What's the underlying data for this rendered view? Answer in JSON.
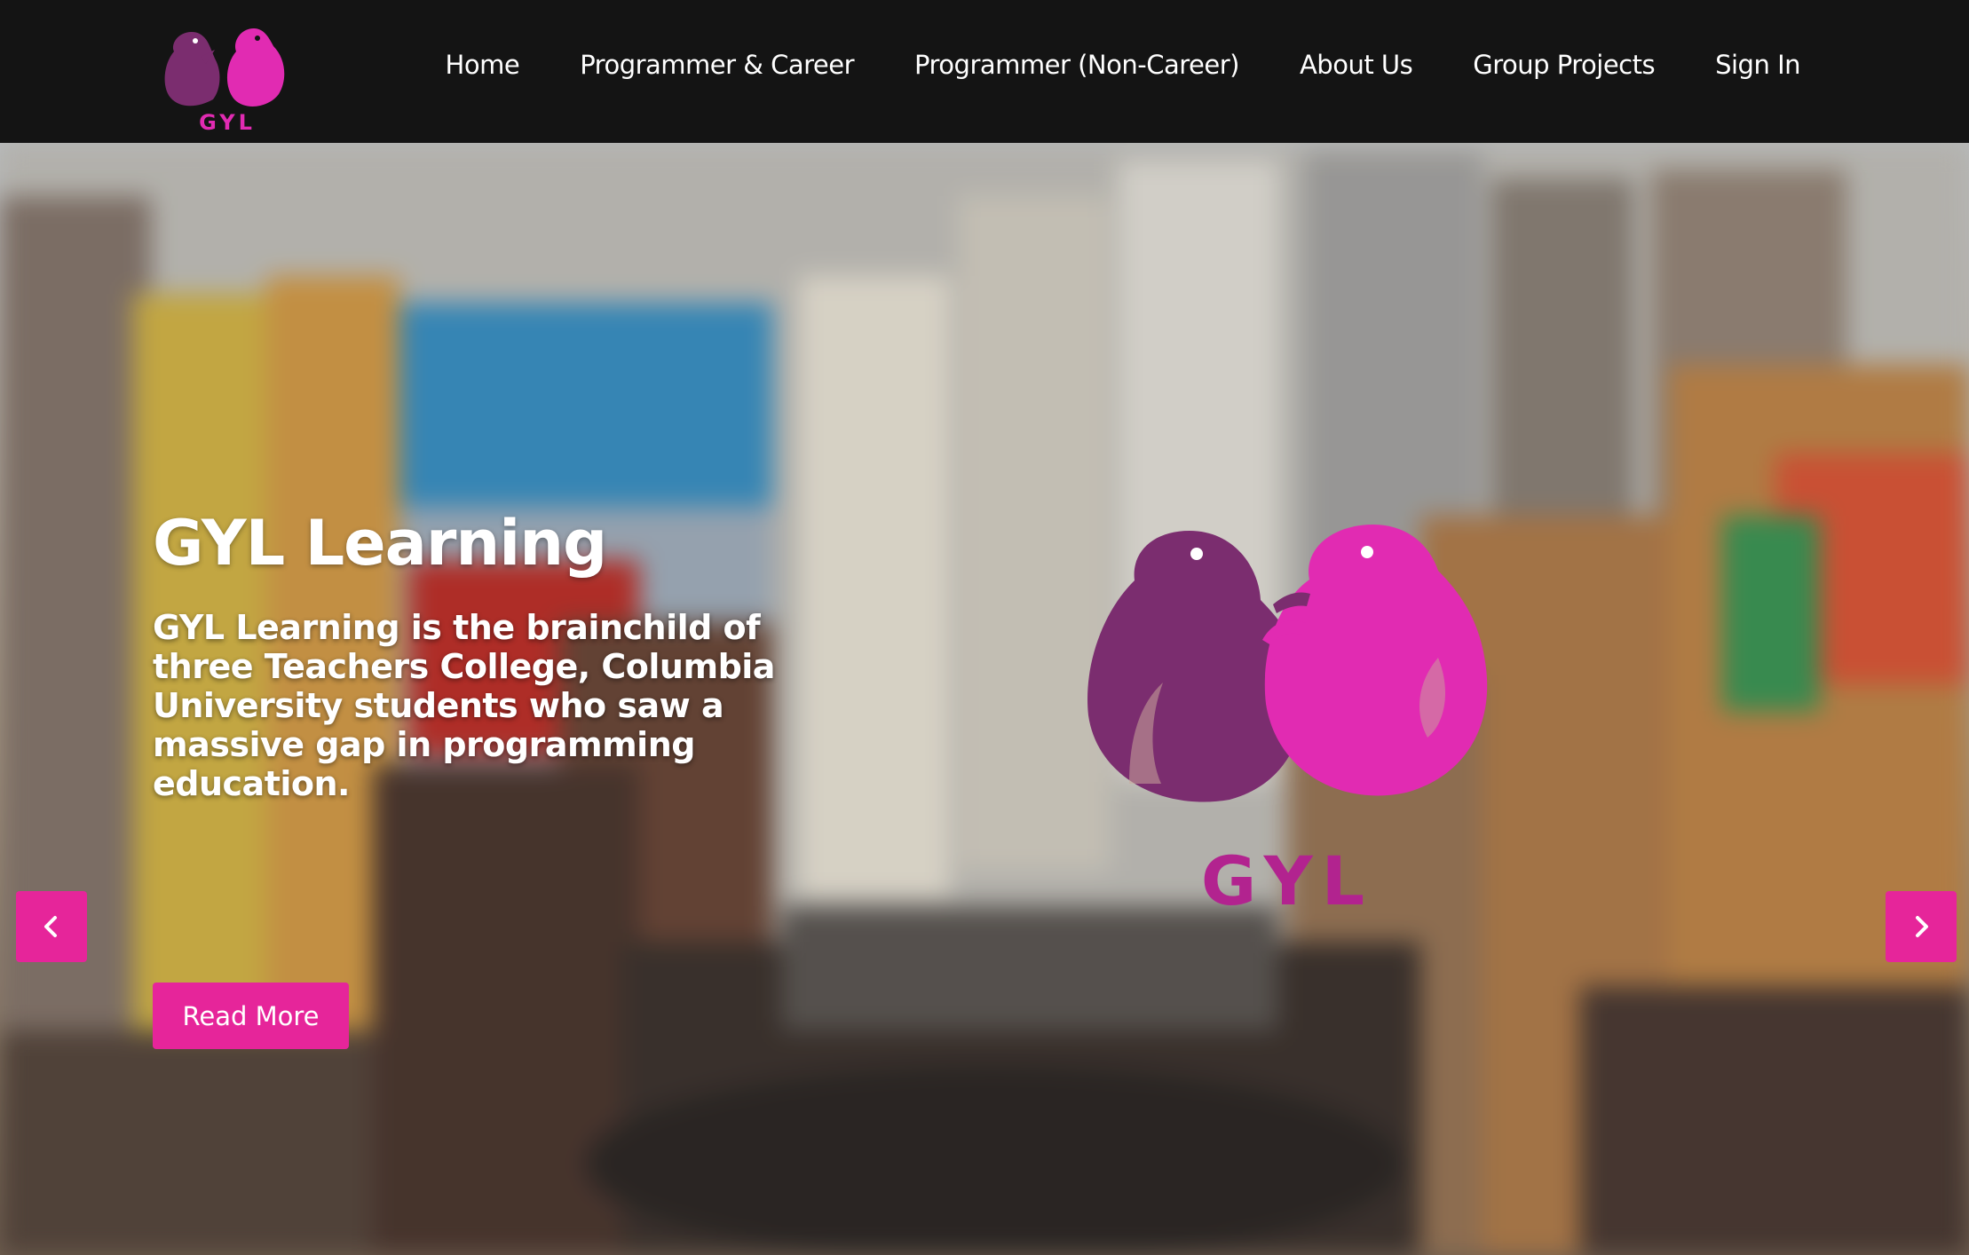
{
  "brand": {
    "logo_text": "GYL",
    "colors": {
      "purple": "#7b2d6f",
      "pink": "#e12bb2",
      "accent": "#e6259a",
      "nav_bg": "#141414"
    }
  },
  "nav": {
    "items": [
      {
        "label": "Home"
      },
      {
        "label": "Programmer & Career"
      },
      {
        "label": "Programmer (Non-Career)"
      },
      {
        "label": "About Us"
      },
      {
        "label": "Group Projects"
      },
      {
        "label": "Sign In"
      }
    ]
  },
  "hero": {
    "title": "GYL Learning",
    "text": "GYL Learning is the brainchild of three Teachers College, Columbia University students who saw a massive gap in programming education.",
    "button_label": "Read More",
    "prev_icon": "chevron-left-icon",
    "next_icon": "chevron-right-icon"
  }
}
